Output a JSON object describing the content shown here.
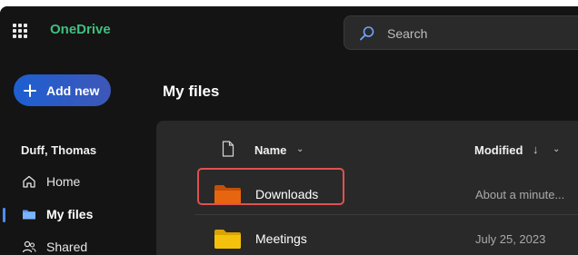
{
  "app": {
    "name": "OneDrive"
  },
  "search": {
    "placeholder": "Search"
  },
  "sidebar": {
    "add_new_label": "Add new",
    "user_name": "Duff, Thomas",
    "items": [
      {
        "label": "Home",
        "icon": "home-icon"
      },
      {
        "label": "My files",
        "icon": "folder-icon",
        "active": true
      },
      {
        "label": "Shared",
        "icon": "people-icon"
      }
    ]
  },
  "main": {
    "title": "My files",
    "columns": {
      "name": "Name",
      "modified": "Modified"
    },
    "rows": [
      {
        "name": "Downloads",
        "modified": "About a minute...",
        "icon": "folder-icon",
        "folder_color": "#e8650f"
      },
      {
        "name": "Meetings",
        "modified": "July 25, 2023",
        "icon": "folder-icon",
        "folder_color": "#f4c20d"
      }
    ]
  },
  "colors": {
    "accent": "#3fbf7f",
    "highlight_box": "#e0514f",
    "active_nav": "#4f8cff"
  }
}
